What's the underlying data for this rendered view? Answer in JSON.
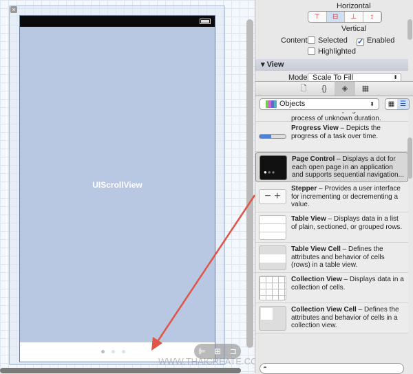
{
  "canvas": {
    "scroll_view_label": "UIScrollView",
    "page_dots": 3,
    "watermark": "WWW.THAICREATE.COM"
  },
  "inspector": {
    "horizontal_label": "Horizontal",
    "vertical_label": "Vertical",
    "content_label": "Content",
    "selected_label": "Selected",
    "selected_checked": false,
    "enabled_label": "Enabled",
    "enabled_checked": true,
    "highlighted_label": "Highlighted",
    "highlighted_checked": false,
    "view_section": "View",
    "mode_label": "Mode",
    "mode_value": "Scale To Fill"
  },
  "library": {
    "selector_value": "Objects",
    "items": [
      {
        "name": "",
        "desc": "feedback on the progress of a task or process of unknown duration."
      },
      {
        "name": "Progress View",
        "desc": " – Depicts the progress of a task over time."
      },
      {
        "name": "Page Control",
        "desc": " – Displays a dot for each open page in an application and supports sequential navigation..."
      },
      {
        "name": "Stepper",
        "desc": " – Provides a user interface for incrementing or decrementing a value."
      },
      {
        "name": "Table View",
        "desc": " – Displays data in a list of plain, sectioned, or grouped rows."
      },
      {
        "name": "Table View Cell",
        "desc": " – Defines the attributes and behavior of cells (rows) in a table view."
      },
      {
        "name": "Collection View",
        "desc": " – Displays data in a collection of cells."
      },
      {
        "name": "Collection View Cell",
        "desc": " – Defines the attributes and behavior of cells in a collection view."
      }
    ]
  },
  "colors": {
    "scroll_view": "#b8c8e3",
    "arrow": "#e05545"
  }
}
